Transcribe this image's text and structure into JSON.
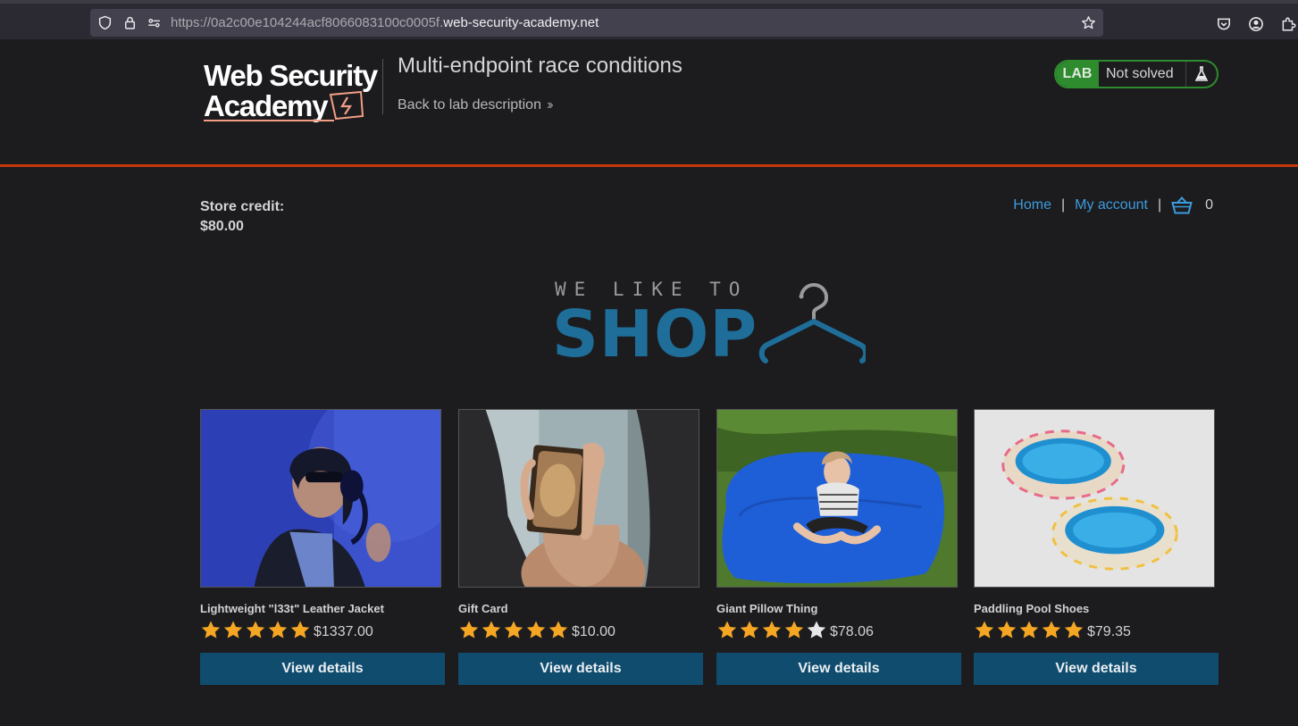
{
  "browser": {
    "url_prefix": "https://0a2c00e104244acf8066083100c0005f.",
    "url_domain": "web-security-academy.net"
  },
  "lab": {
    "logo_line1": "Web Security",
    "logo_line2": "Academy",
    "title": "Multi-endpoint race conditions",
    "back_link": "Back to lab description",
    "badge": "LAB",
    "status": "Not solved"
  },
  "store": {
    "credit_label": "Store credit:",
    "credit_value": "$80.00",
    "nav_home": "Home",
    "nav_account": "My account",
    "cart_count": "0"
  },
  "banner": {
    "sub": "WE LIKE TO",
    "main": "SHOP"
  },
  "products": [
    {
      "name": "Lightweight \"l33t\" Leather Jacket",
      "rating": 5,
      "price": "$1337.00",
      "button": "View details"
    },
    {
      "name": "Gift Card",
      "rating": 5,
      "price": "$10.00",
      "button": "View details"
    },
    {
      "name": "Giant Pillow Thing",
      "rating": 4,
      "price": "$78.06",
      "button": "View details"
    },
    {
      "name": "Paddling Pool Shoes",
      "rating": 5,
      "price": "$79.35",
      "button": "View details"
    }
  ],
  "colors": {
    "accent_orange": "#c8360b",
    "link_blue": "#3d9bdc",
    "button_blue": "#0f4c6e",
    "lab_green": "#2e8b2e",
    "star_gold": "#f5a623"
  }
}
